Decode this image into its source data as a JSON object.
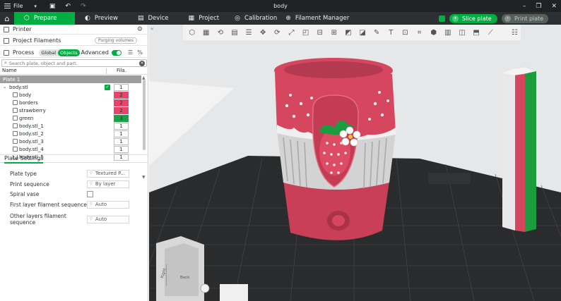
{
  "window": {
    "menu_label": "File",
    "title": "body"
  },
  "tabs": [
    {
      "label": "Prepare",
      "active": true
    },
    {
      "label": "Preview"
    },
    {
      "label": "Device"
    },
    {
      "label": "Project"
    },
    {
      "label": "Calibration"
    },
    {
      "label": "Filament Manager"
    }
  ],
  "actions": {
    "slice_label": "Slice plate",
    "print_label": "Print plate"
  },
  "sidebar": {
    "printer_label": "Printer",
    "project_filaments_label": "Project Filaments",
    "purging_label": "Purging volumes",
    "process_label": "Process",
    "global_label": "Global",
    "objects_label": "Objects",
    "advanced_label": "Advanced",
    "search_placeholder": "Search plate, object and part.",
    "col_name": "Name",
    "col_fila": "Fila."
  },
  "tree": {
    "plate": "Plate 1",
    "object": "body.stl",
    "object_fila": "1",
    "rows": [
      {
        "name": "body",
        "fila": "2",
        "color": "#e8456b"
      },
      {
        "name": "borders",
        "fila": "2",
        "color": "#e8456b"
      },
      {
        "name": "strawberry",
        "fila": "2",
        "color": "#e8456b"
      },
      {
        "name": "green",
        "fila": "3",
        "color": "#1aa145"
      },
      {
        "name": "body.stl_1",
        "fila": "1",
        "color": "#ffffff"
      },
      {
        "name": "body.stl_2",
        "fila": "1",
        "color": "#ffffff"
      },
      {
        "name": "body.stl_3",
        "fila": "1",
        "color": "#ffffff"
      },
      {
        "name": "body.stl_4",
        "fila": "1",
        "color": "#ffffff"
      },
      {
        "name": "body.stl_5",
        "fila": "1",
        "color": "#ffffff"
      }
    ]
  },
  "plate_settings": {
    "tab_label": "Plate Settings",
    "rows": [
      {
        "label": "Plate type",
        "value": "Textured P..."
      },
      {
        "label": "Print sequence",
        "value": "By layer"
      },
      {
        "label": "Spiral vase",
        "value": ""
      },
      {
        "label": "First layer filament sequence",
        "value": "Auto"
      },
      {
        "label": "Other layers filament",
        "value": "Auto"
      }
    ],
    "other_layers_second_line": "sequence"
  },
  "viewcube": {
    "right_label": "Right",
    "back_label": "Back"
  },
  "colors": {
    "accent": "#00ae42",
    "model_pink": "#d6465e",
    "model_gray": "#d4d4d4",
    "model_green": "#1b9c3e"
  }
}
